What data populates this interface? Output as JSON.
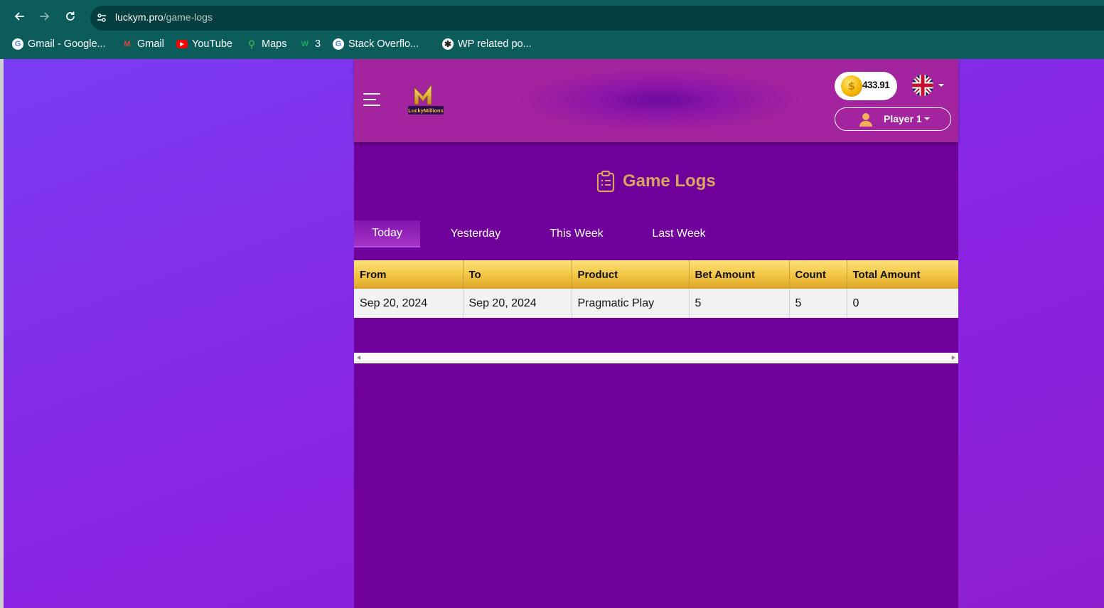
{
  "browser": {
    "url_host": "luckym.pro",
    "url_path": "/game-logs",
    "bookmarks": [
      {
        "label": "Gmail - Google...",
        "icon": "google-icon"
      },
      {
        "label": "Gmail",
        "icon": "gmail-icon"
      },
      {
        "label": "YouTube",
        "icon": "youtube-icon"
      },
      {
        "label": "Maps",
        "icon": "maps-icon"
      },
      {
        "label": "3",
        "icon": "w-icon"
      },
      {
        "label": "Stack Overflo...",
        "icon": "google-icon"
      },
      {
        "label": "WP related po...",
        "icon": "openai-icon"
      }
    ]
  },
  "header": {
    "logo_text": "LuckyMillions",
    "balance": "433.91",
    "language_icon": "uk-flag-icon",
    "player_name": "Player 1"
  },
  "page": {
    "title": "Game Logs",
    "tabs": [
      "Today",
      "Yesterday",
      "This Week",
      "Last Week"
    ],
    "active_tab": "Today"
  },
  "table": {
    "columns": [
      "From",
      "To",
      "Product",
      "Bet Amount",
      "Count",
      "Total Amount"
    ],
    "rows": [
      [
        "Sep 20, 2024",
        "Sep 20, 2024",
        "Pragmatic Play",
        "5",
        "5",
        "0"
      ]
    ]
  },
  "colors": {
    "page_bg": "#6f0099",
    "title_gold": "#d7a560",
    "table_header_gold": "#f2c440",
    "browser_teal": "#0d5c5c"
  }
}
